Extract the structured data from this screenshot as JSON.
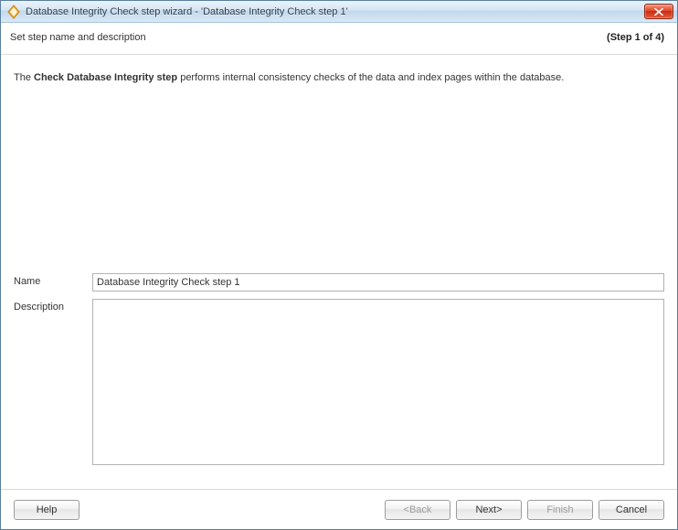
{
  "window": {
    "title": "Database Integrity Check step wizard - 'Database Integrity Check step 1'"
  },
  "subheader": {
    "left": "Set step name and description",
    "right": "(Step 1 of 4)"
  },
  "intro": {
    "prefix": "The ",
    "strong": "Check Database Integrity step",
    "suffix": " performs internal consistency checks of the data and index pages within the database."
  },
  "form": {
    "name_label": "Name",
    "name_value": "Database Integrity Check step 1",
    "desc_label": "Description",
    "desc_value": ""
  },
  "buttons": {
    "help": "Help",
    "back": "<Back",
    "next": "Next>",
    "finish": "Finish",
    "cancel": "Cancel"
  }
}
